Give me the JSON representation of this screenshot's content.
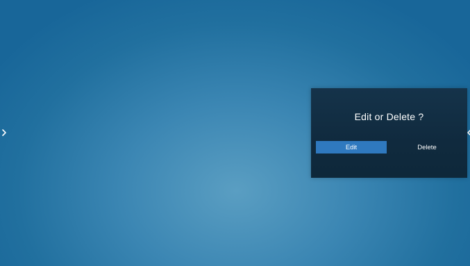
{
  "dialog": {
    "title": "Edit or Delete ?",
    "buttons": {
      "edit_label": "Edit",
      "delete_label": "Delete"
    },
    "selected": "edit"
  },
  "navigation": {
    "left_icon": "chevron-right-icon",
    "right_icon": "chevron-left-icon"
  },
  "colors": {
    "background_center": "#5a9ec2",
    "background_edge": "#186699",
    "dialog_background": "#102a3e",
    "accent": "#2f79bf",
    "text": "#ffffff"
  }
}
